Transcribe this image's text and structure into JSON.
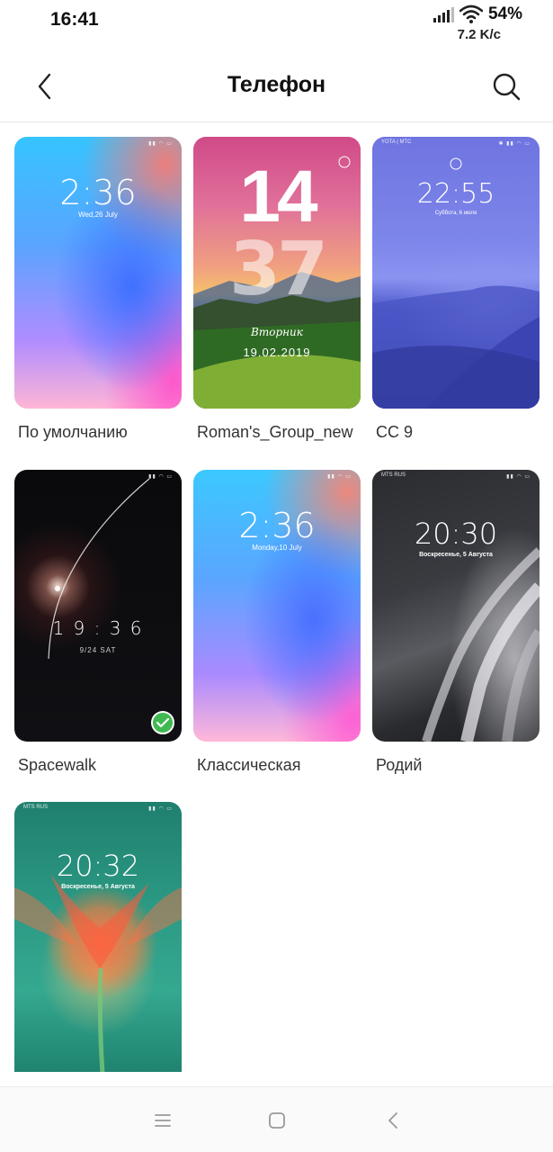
{
  "status_bar": {
    "time": "16:41",
    "battery": "54%",
    "net_speed": "7.2 K/c"
  },
  "header": {
    "title": "Телефон"
  },
  "themes": [
    {
      "label": "По умолчанию",
      "clock": "2:36",
      "date": "Wed,26  July"
    },
    {
      "label": "Roman's_Group_new",
      "clock_hours": "14",
      "clock_minutes": "37",
      "day": "Вторник",
      "date": "19.02.2019"
    },
    {
      "label": "CC 9",
      "carrier": "YOTA | MTC",
      "clock": "22:55",
      "date": "Суббота, 6 июля"
    },
    {
      "label": "Spacewalk",
      "clock": "1 9 : 3 6",
      "date": "9/24  SAT",
      "applied": true
    },
    {
      "label": "Классическая",
      "clock": "2:36",
      "date": "Monday,10  July"
    },
    {
      "label": "Родий",
      "carrier": "MTS RUS",
      "clock": "20:30",
      "date": "Воскресенье, 5 Августа"
    },
    {
      "label": "",
      "carrier": "MTS RUS",
      "clock": "20:32",
      "date": "Воскресенье, 5 Августа"
    }
  ],
  "colors": {
    "applied_badge": "#3fb950",
    "title": "#111111"
  }
}
